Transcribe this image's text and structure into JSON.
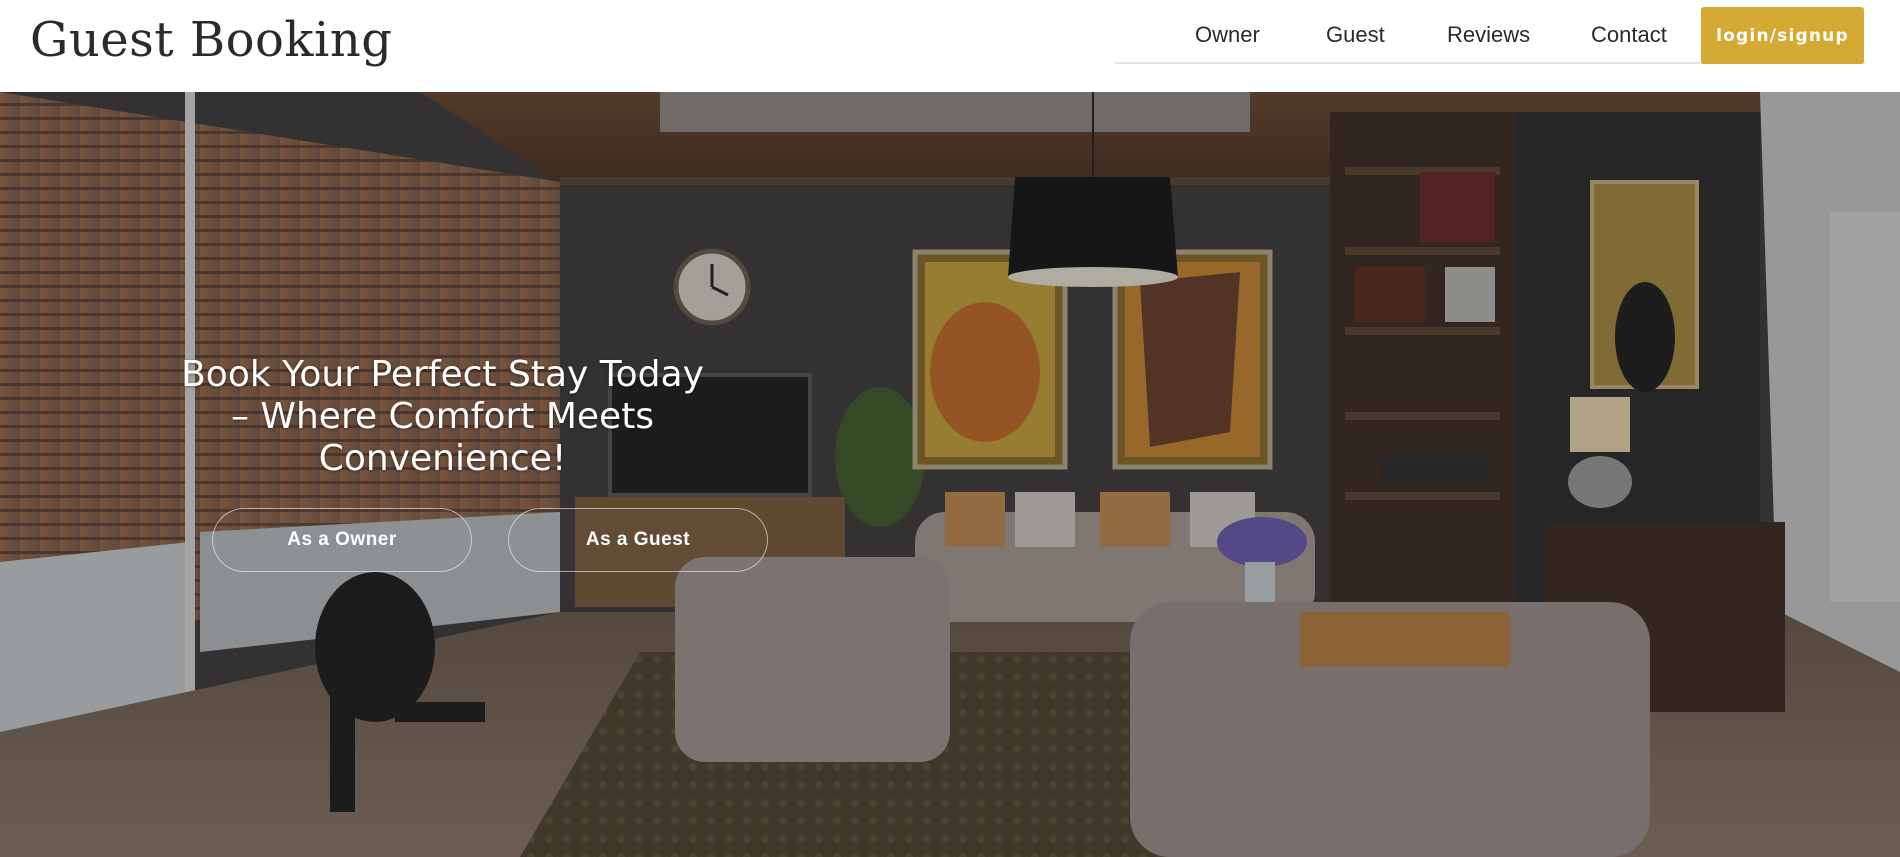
{
  "header": {
    "brand": "Guest Booking",
    "nav": [
      "Owner",
      "Guest",
      "Reviews",
      "Contact"
    ],
    "login_label": "login/signup"
  },
  "hero": {
    "title": "Book Your Perfect Stay Today – Where Comfort Meets Convenience!",
    "owner_button": "As a Owner",
    "guest_button": "As a Guest"
  },
  "colors": {
    "accent": "#d4a934",
    "text_dark": "#2b2b2b",
    "hero_text": "#ffffff"
  }
}
